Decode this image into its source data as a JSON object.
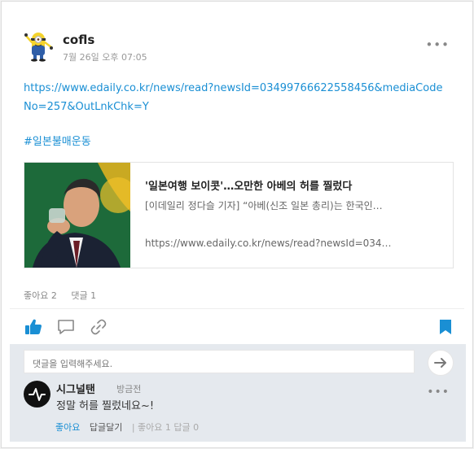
{
  "post": {
    "author": "cofls",
    "time": "7월 26일 오후 07:05",
    "more": "•••",
    "url": "https://www.edaily.co.kr/news/read?newsId=03499766622558456&mediaCodeNo=257&OutLnkChk=Y",
    "hashtag": "#일본불매운동"
  },
  "preview": {
    "title": "'일본여행 보이콧'…오만한 아베의 허를 찔렀다",
    "description": "[이데일리 정다슬 기자] “아베(신조 일본 총리)는 한국인…",
    "url": "https://www.edaily.co.kr/news/read?newsId=034…"
  },
  "counts": {
    "likes": "좋아요 2",
    "comments": "댓글 1"
  },
  "actions": {
    "like_icon": "thumbs-up-icon",
    "comment_icon": "speech-bubble-icon",
    "link_icon": "chain-link-icon",
    "bookmark_icon": "bookmark-icon",
    "accent": "#1a8fd4"
  },
  "comment_box": {
    "placeholder": "댓글을 입력해주세요."
  },
  "comment": {
    "author": "시그널탠",
    "time": "방금전",
    "text": "정말 허를 찔렀네요~!",
    "more": "•••",
    "like": "좋아요",
    "reply": "답글달기",
    "like_count": "| 좋아요 1",
    "reply_count": "답글 0"
  }
}
